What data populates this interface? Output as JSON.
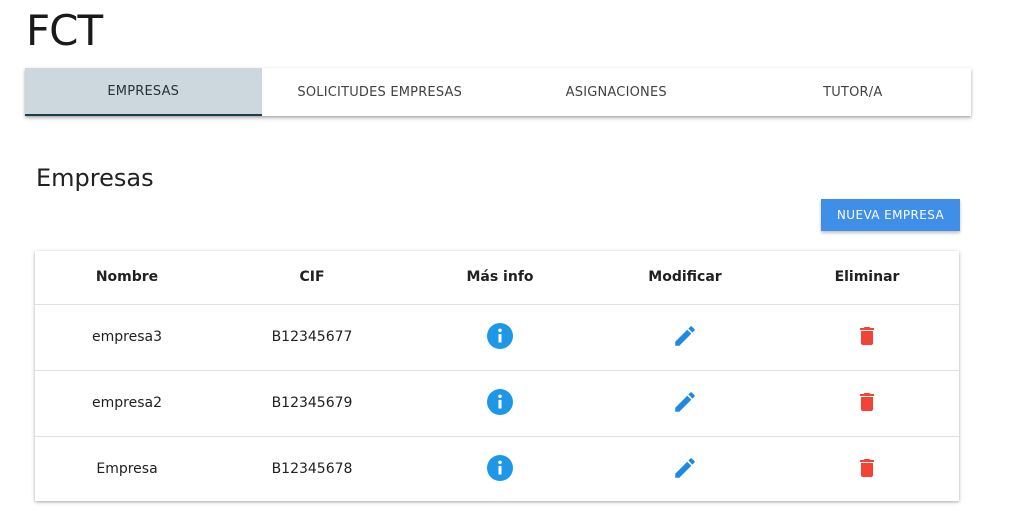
{
  "app": {
    "title": "FCT"
  },
  "tabs": [
    {
      "label": "EMPRESAS",
      "active": true
    },
    {
      "label": "SOLICITUDES EMPRESAS",
      "active": false
    },
    {
      "label": "ASIGNACIONES",
      "active": false
    },
    {
      "label": "TUTOR/A",
      "active": false
    }
  ],
  "section": {
    "title": "Empresas"
  },
  "toolbar": {
    "new_button_label": "NUEVA EMPRESA"
  },
  "table": {
    "headers": [
      "Nombre",
      "CIF",
      "Más info",
      "Modificar",
      "Eliminar"
    ],
    "rows": [
      {
        "nombre": "empresa3",
        "cif": "B12345677",
        "info_icon": "info-icon",
        "edit_icon": "pencil-icon",
        "delete_icon": "trash-icon"
      },
      {
        "nombre": "empresa2",
        "cif": "B12345679",
        "info_icon": "info-icon",
        "edit_icon": "pencil-icon",
        "delete_icon": "trash-icon"
      },
      {
        "nombre": "Empresa",
        "cif": "B12345678",
        "info_icon": "info-icon",
        "edit_icon": "pencil-icon",
        "delete_icon": "trash-icon"
      }
    ]
  },
  "colors": {
    "active_tab_bg": "#ccd8dd",
    "active_tab_indicator": "#1b3e4a",
    "primary_button": "#3f8fe8",
    "info_icon": "#1e98e6",
    "edit_icon": "#1e88e5",
    "delete_icon": "#f44336"
  }
}
